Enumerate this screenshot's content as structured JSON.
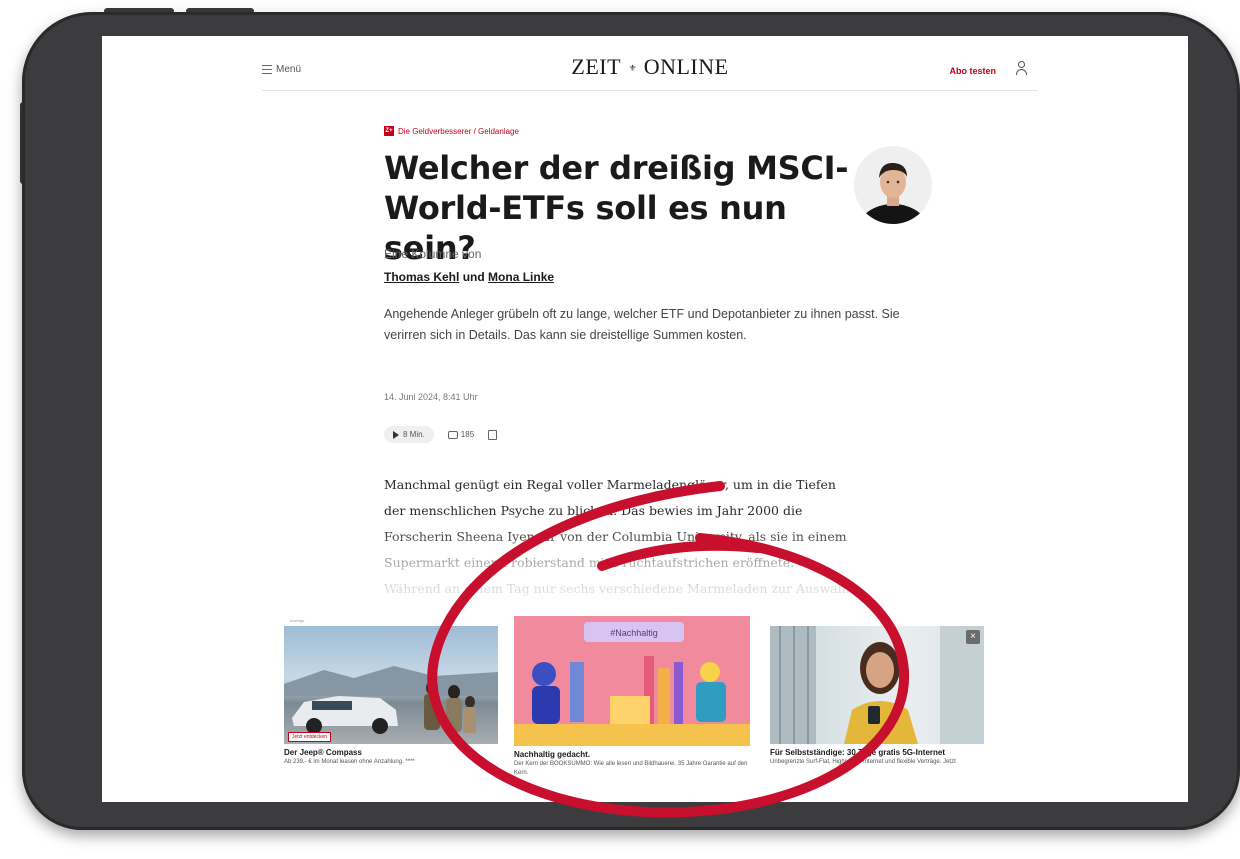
{
  "header": {
    "menu_label": "Menü",
    "logo_left": "ZEIT",
    "logo_mark": "⚜",
    "logo_right": "ONLINE",
    "abo_label": "Abo testen"
  },
  "article": {
    "kicker_badge": "Z+",
    "kicker": "Die Geldverbesserer / Geldanlage",
    "headline_line1": "Welcher der dreißig MSCI-",
    "headline_line2": "World-ETFs soll es nun sein?",
    "column_label": "Eine Kolumne von",
    "author1": "Thomas Kehl",
    "author_join": "und",
    "author2": "Mona Linke",
    "teaser": "Angehende Anleger grübeln oft zu lange, welcher ETF und Depotanbieter zu ihnen passt. Sie verirren sich in Details. Das kann sie dreistellige Summen kosten.",
    "date": "14. Juni 2024, 8:41 Uhr",
    "listen_label": "8 Min.",
    "comment_count": "185",
    "body": [
      "Manchmal genügt ein Regal voller Marmeladengläser, um in die Tiefen",
      "der menschlichen Psyche zu blicken. Das bewies im Jahr 2000 die",
      "Forscherin Sheena Iyengar von der Columbia University, als sie in einem",
      "Supermarkt einen Probierstand mit Fruchtaufstrichen eröffnete.",
      "Während an einem Tag nur sechs verschiedene Marmeladen zur Auswahl"
    ]
  },
  "ads": {
    "label": "Anzeige",
    "items": [
      {
        "title": "Der Jeep® Compass",
        "desc": "Ab 239,- € im Monat leasen ohne Anzahlung. ****",
        "tag": "Jetzt entdecken"
      },
      {
        "title": "Nachhaltig gedacht.",
        "desc": "Der Kern der BOOKSUMMO: Wie alle lesen und Bildhauerei. 35 Jahre Garantie auf den Kern.",
        "banner": "#Nachhaltig"
      },
      {
        "title": "Für Selbstständige: 30 Tage gratis 5G-Internet",
        "desc": "Unbegrenzte Surf-Flat, Highspeed-Internet und flexible Verträge. Jetzt",
        "close": "×"
      }
    ]
  },
  "colors": {
    "accent_red": "#c4001a",
    "annotation_red": "#c8102e",
    "frame": "#3c3c3e"
  }
}
